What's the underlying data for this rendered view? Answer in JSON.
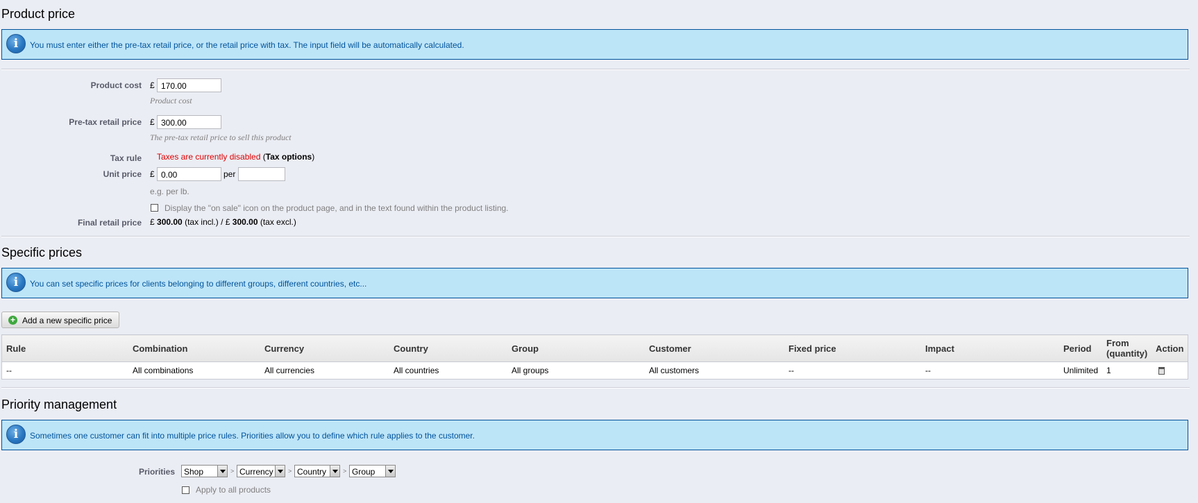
{
  "product_price": {
    "title": "Product price",
    "info": "You must enter either the pre-tax retail price, or the retail price with tax. The input field will be automatically calculated.",
    "currency_symbol": "£",
    "product_cost": {
      "label": "Product cost",
      "value": "170.00",
      "hint": "Product cost"
    },
    "pretax_price": {
      "label": "Pre-tax retail price",
      "value": "300.00",
      "hint": "The pre-tax retail price to sell this product"
    },
    "tax_rule": {
      "label": "Tax rule",
      "status": "Taxes are currently disabled",
      "open_paren": "(",
      "link": "Tax options",
      "close_paren": ")"
    },
    "unit_price": {
      "label": "Unit price",
      "value": "0.00",
      "per_label": "per",
      "per_value": "",
      "hint": "e.g. per lb."
    },
    "on_sale": {
      "label": "Display the \"on sale\" icon on the product page, and in the text found within the product listing.",
      "checked": false
    },
    "final_price": {
      "label": "Final retail price",
      "cur1": "£",
      "incl_value": "300.00",
      "incl_label": "(tax incl.) /",
      "cur2": "£",
      "excl_value": "300.00",
      "excl_label": "(tax excl.)"
    }
  },
  "specific_prices": {
    "title": "Specific prices",
    "info": "You can set specific prices for clients belonging to different groups, different countries, etc...",
    "add_button": "Add a new specific price",
    "columns": [
      "Rule",
      "Combination",
      "Currency",
      "Country",
      "Group",
      "Customer",
      "Fixed price",
      "Impact",
      "Period",
      "From (quantity)",
      "Action"
    ],
    "rows": [
      [
        "--",
        "All combinations",
        "All currencies",
        "All countries",
        "All groups",
        "All customers",
        "--",
        "--",
        "Unlimited",
        "1"
      ]
    ]
  },
  "priority": {
    "title": "Priority management",
    "info": "Sometimes one customer can fit into multiple price rules. Priorities allow you to define which rule applies to the customer.",
    "label": "Priorities",
    "selects": [
      "Shop",
      "Currency",
      "Country",
      "Group"
    ],
    "separator": ">",
    "apply_all": "Apply to all products"
  },
  "icons": {
    "info": "info-icon",
    "add": "plus-circle-icon",
    "delete": "trash-icon",
    "dropdown": "chevron-down-icon"
  },
  "colors": {
    "info_bg": "#bde5f8",
    "info_text": "#00529b",
    "error_text": "#e00000",
    "page_bg": "#ebedf4"
  }
}
